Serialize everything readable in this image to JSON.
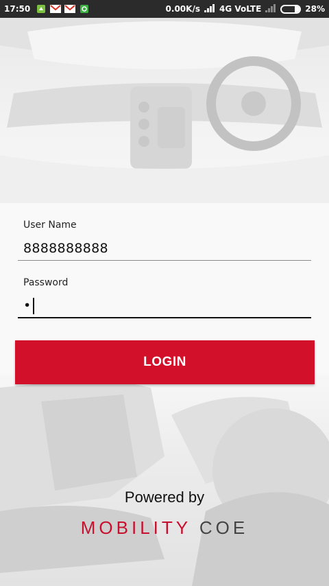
{
  "status_bar": {
    "time": "17:50",
    "speed": "0.00K/s",
    "network": "4G VoLTE",
    "battery": "28%",
    "battery_level": 0.28
  },
  "form": {
    "username_label": "User Name",
    "username_value": "8888888888",
    "password_label": "Password",
    "password_value": "•"
  },
  "login_button": "LOGIN",
  "footer": {
    "powered_by": "Powered by",
    "brand_part1": "MOBILITY",
    "brand_part2": "COE"
  },
  "colors": {
    "accent": "#d3102a",
    "status_bar": "#2b2b2b"
  }
}
